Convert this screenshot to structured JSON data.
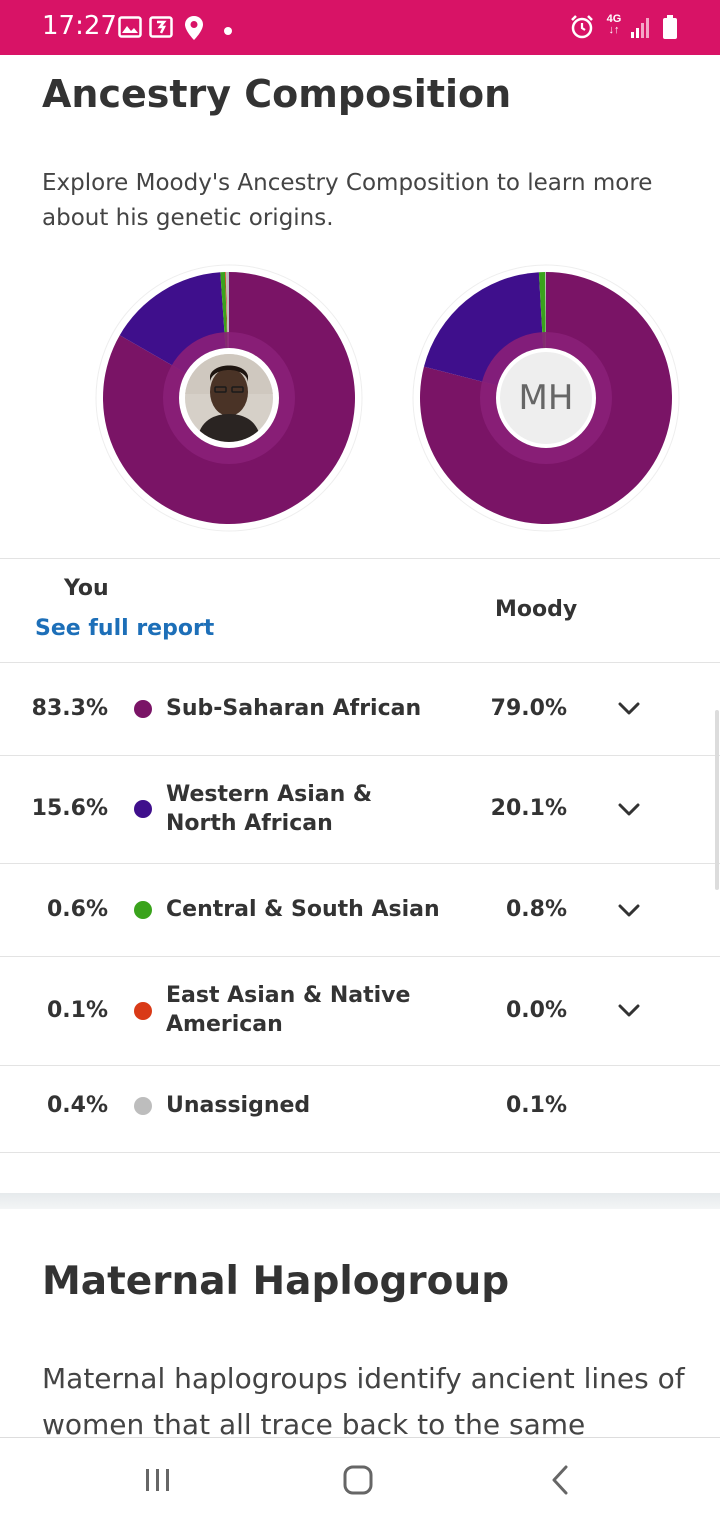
{
  "status_bar": {
    "time": "17:27",
    "network": "4G",
    "background": "#d81366"
  },
  "ancestry": {
    "title": "Ancestry Composition",
    "intro": "Explore Moody's Ancestry Composition to learn more about his genetic origins.",
    "you_avatar": "user-photo",
    "moody_initials": "MH"
  },
  "table": {
    "you_header": "You",
    "see_full_report": "See full report",
    "moody_header": "Moody",
    "rows": [
      {
        "you": "83.3%",
        "name": "Sub-Saharan African",
        "moody": "79.0%",
        "color": "#7a1466",
        "expandable": true
      },
      {
        "you": "15.6%",
        "name": "Western Asian & North African",
        "moody": "20.1%",
        "color": "#3f0f8c",
        "expandable": true
      },
      {
        "you": "0.6%",
        "name": "Central & South Asian",
        "moody": "0.8%",
        "color": "#3aa31c",
        "expandable": true
      },
      {
        "you": "0.1%",
        "name": "East Asian & Native American",
        "moody": "0.0%",
        "color": "#d93a17",
        "expandable": true
      },
      {
        "you": "0.4%",
        "name": "Unassigned",
        "moody": "0.1%",
        "color": "#bdbdbd",
        "expandable": false
      }
    ]
  },
  "maternal": {
    "title": "Maternal Haplogroup",
    "intro": "Maternal haplogroups identify ancient lines of women that all trace back to the same"
  },
  "nav": {
    "recent_icon": "recent-apps-icon",
    "home_icon": "home-icon",
    "back_icon": "back-icon"
  }
}
